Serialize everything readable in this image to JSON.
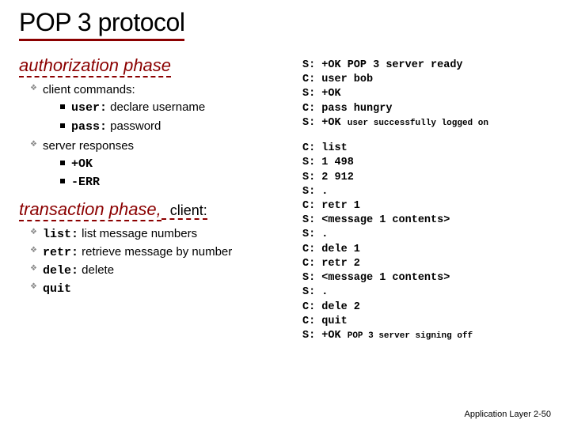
{
  "title": "POP 3 protocol",
  "phase1": {
    "heading": "authorization phase",
    "items": [
      {
        "label": "client commands:",
        "sub": [
          {
            "cmd": "user:",
            "desc": " declare username"
          },
          {
            "cmd": "pass:",
            "desc": " password"
          }
        ]
      },
      {
        "label": "server responses",
        "sub": [
          {
            "cmd": "+OK",
            "desc": ""
          },
          {
            "cmd": "-ERR",
            "desc": ""
          }
        ]
      }
    ]
  },
  "phase2": {
    "heading": "transaction phase,",
    "suffix": " client:",
    "items": [
      {
        "cmd": "list:",
        "desc": " list message numbers"
      },
      {
        "cmd": "retr:",
        "desc": " retrieve message by number"
      },
      {
        "cmd": "dele:",
        "desc": " delete"
      },
      {
        "cmd": "quit",
        "desc": ""
      }
    ]
  },
  "session": {
    "l1": "S: +OK POP 3 server ready",
    "l2": "C: user bob",
    "l3": "S: +OK",
    "l4": "C: pass hungry",
    "l5a": "S: +OK ",
    "l5b": "user successfully logged on",
    "l6": "C: list",
    "l7": "S: 1 498",
    "l8": "S: 2 912",
    "l9": "S: .",
    "l10": "C: retr 1",
    "l11": "S: <message 1 contents>",
    "l12": "S: .",
    "l13": "C: dele 1",
    "l14": "C: retr 2",
    "l15": "S: <message 1 contents>",
    "l16": "S: .",
    "l17": "C: dele 2",
    "l18": "C: quit",
    "l19a": "S: +OK ",
    "l19b": "POP 3 server signing off"
  },
  "footer": {
    "label": "Application Layer",
    "page": " 2-50"
  }
}
